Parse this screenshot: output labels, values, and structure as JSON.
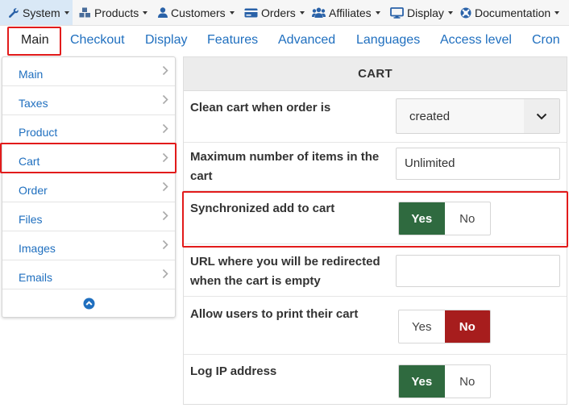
{
  "topmenu": {
    "items": [
      {
        "label": "System",
        "icon": "wrench-icon"
      },
      {
        "label": "Products",
        "icon": "cubes-icon"
      },
      {
        "label": "Customers",
        "icon": "user-icon"
      },
      {
        "label": "Orders",
        "icon": "credit-card-icon"
      },
      {
        "label": "Affiliates",
        "icon": "users-icon"
      },
      {
        "label": "Display",
        "icon": "desktop-icon"
      },
      {
        "label": "Documentation",
        "icon": "lifebuoy-icon"
      }
    ]
  },
  "tabs": [
    "Main",
    "Checkout",
    "Display",
    "Features",
    "Advanced",
    "Languages",
    "Access level",
    "Cron"
  ],
  "sidebar": {
    "items": [
      "Main",
      "Taxes",
      "Product",
      "Cart",
      "Order",
      "Files",
      "Images",
      "Emails"
    ],
    "active": "Cart"
  },
  "panel": {
    "title": "CART",
    "clean_cart": {
      "label": "Clean cart when order is",
      "value": "created"
    },
    "max_items": {
      "label": "Maximum number of items in the cart",
      "placeholder": "Unlimited"
    },
    "sync_add": {
      "label": "Synchronized add to cart",
      "yes": "Yes",
      "no": "No",
      "selected": "yes"
    },
    "redirect_url": {
      "label": "URL where you will be redirected when the cart is empty",
      "value": ""
    },
    "print_cart": {
      "label": "Allow users to print their cart",
      "yes": "Yes",
      "no": "No",
      "selected": "no"
    },
    "log_ip": {
      "label": "Log IP address",
      "yes": "Yes",
      "no": "No",
      "selected": "yes"
    }
  },
  "colors": {
    "link": "#1f6fbf",
    "yes_active": "#2f6a3f",
    "no_active": "#a71d1d",
    "highlight": "#e21b1b"
  }
}
